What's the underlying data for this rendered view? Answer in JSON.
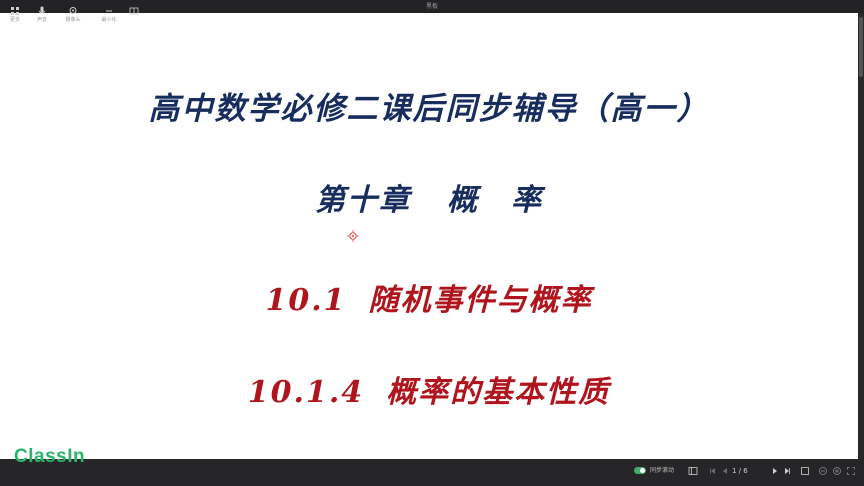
{
  "window": {
    "title": "黑板"
  },
  "slide": {
    "title": "高中数学必修二课后同步辅导（高一）",
    "chapter_number": "第十章",
    "chapter_name": "概　率",
    "section_number": "10.1",
    "section_name": "随机事件与概率",
    "subsection_number": "10.1.4",
    "subsection_name": "概率的基本性质"
  },
  "branding": {
    "logo": "ClassIn"
  },
  "toolbar": {
    "items": [
      {
        "label": "更多",
        "icon": "grid-icon"
      },
      {
        "label": "声音",
        "icon": "microphone-icon"
      },
      {
        "label": "摄像头",
        "icon": "camera-icon"
      },
      {
        "label": "最小化",
        "icon": "minimize-icon"
      },
      {
        "label": "",
        "icon": "layout-icon"
      }
    ],
    "sync_label": "同步滚动",
    "page": "1 / 6"
  },
  "colors": {
    "title_blue": "#172d5e",
    "section_red": "#b0141c",
    "logo_green": "#2bb36a",
    "toggle_green": "#3fae6a"
  }
}
